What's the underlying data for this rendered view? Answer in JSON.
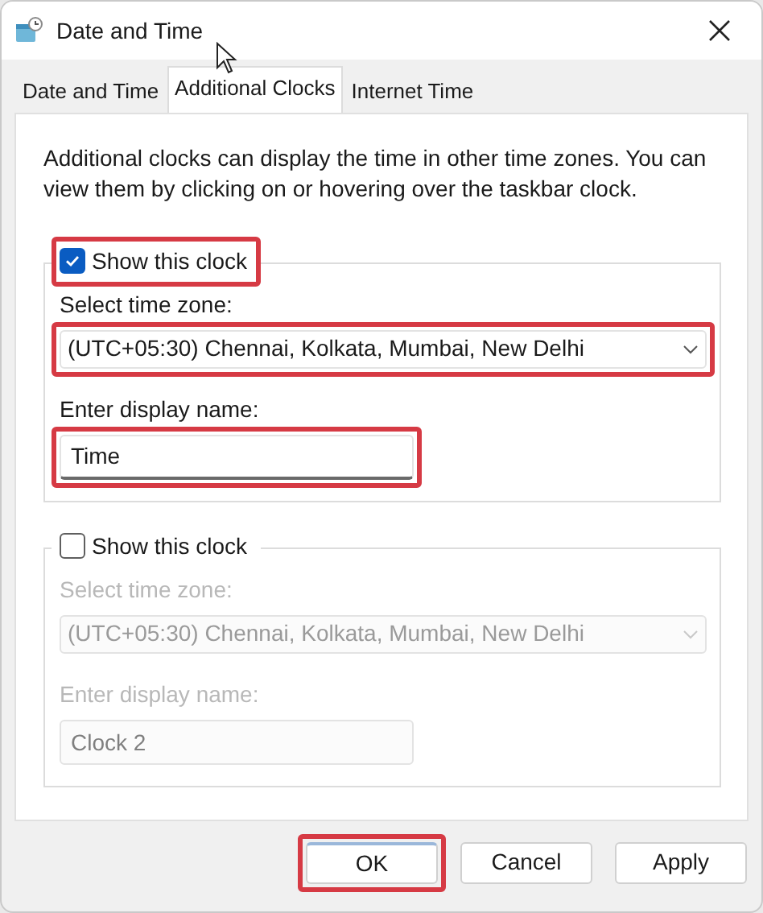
{
  "window": {
    "title": "Date and Time"
  },
  "tabs": [
    {
      "label": "Date and Time",
      "selected": false
    },
    {
      "label": "Additional Clocks",
      "selected": true
    },
    {
      "label": "Internet Time",
      "selected": false
    }
  ],
  "description": "Additional clocks can display the time in other time zones. You can view them by clicking on or hovering over the taskbar clock.",
  "clocks": [
    {
      "show": {
        "label": "Show this clock",
        "checked": true,
        "highlighted": true
      },
      "enabled": true,
      "time_zone": {
        "label": "Select time zone:",
        "value": "(UTC+05:30) Chennai, Kolkata, Mumbai, New Delhi",
        "highlighted": true
      },
      "display_name": {
        "label": "Enter display name:",
        "value": "Time",
        "highlighted": true
      }
    },
    {
      "show": {
        "label": "Show this clock",
        "checked": false,
        "highlighted": false
      },
      "enabled": false,
      "time_zone": {
        "label": "Select time zone:",
        "value": "(UTC+05:30) Chennai, Kolkata, Mumbai, New Delhi",
        "highlighted": false
      },
      "display_name": {
        "label": "Enter display name:",
        "value": "Clock 2",
        "highlighted": false
      }
    }
  ],
  "buttons": [
    {
      "label": "OK",
      "default": true,
      "highlighted": true
    },
    {
      "label": "Cancel",
      "default": false,
      "highlighted": false
    },
    {
      "label": "Apply",
      "default": false,
      "highlighted": false
    }
  ]
}
